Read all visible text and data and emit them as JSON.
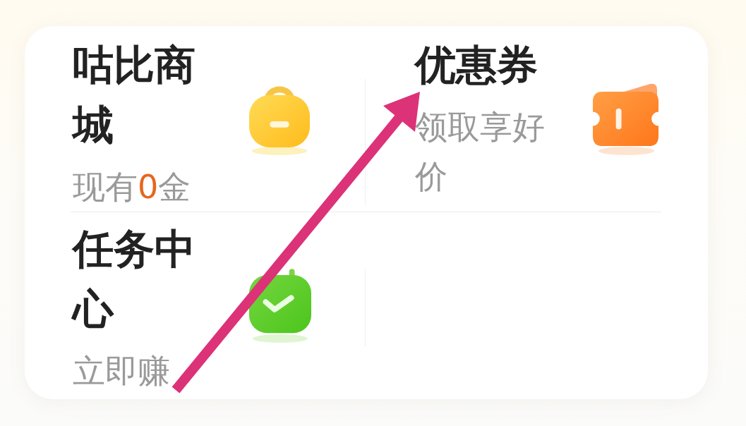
{
  "shortcuts": [
    {
      "kind": "mall",
      "title": "咕比商城",
      "subtitle": "现有**0**金"
    },
    {
      "kind": "coupon",
      "title": "优惠券",
      "subtitle": "领取享好价"
    },
    {
      "kind": "task",
      "title": "任务中心",
      "subtitle": "立即赚"
    }
  ]
}
